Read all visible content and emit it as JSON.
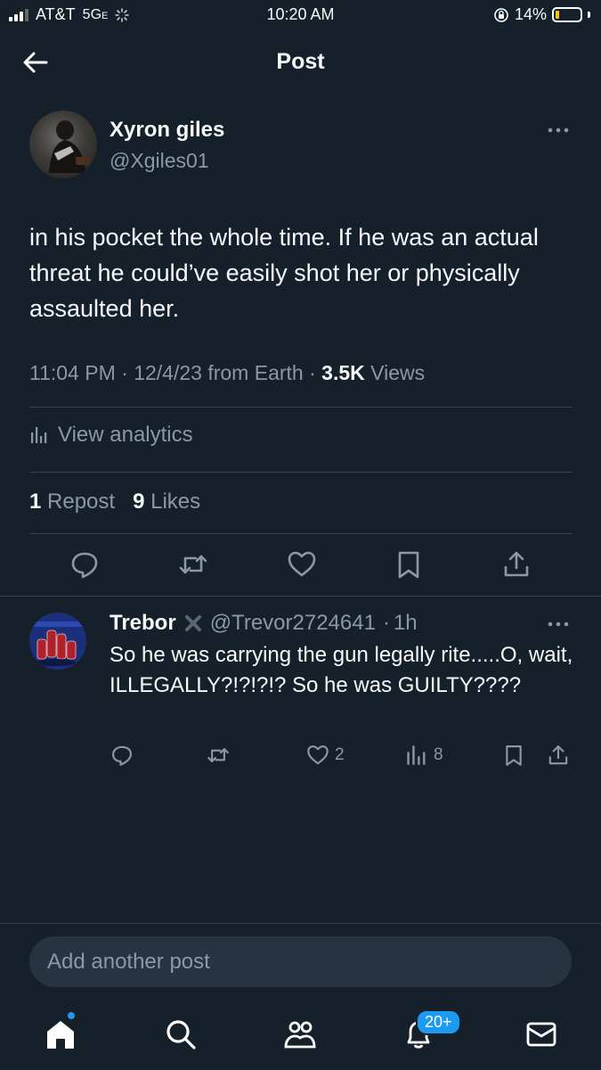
{
  "status_bar": {
    "carrier": "AT&T",
    "network": "5G",
    "network_suffix": "E",
    "time": "10:20 AM",
    "battery": "14%",
    "battery_level": 0.14
  },
  "header": {
    "title": "Post"
  },
  "post": {
    "author_name": "Xyron giles",
    "author_handle": "@Xgiles01",
    "text": "in his pocket the whole time. If he was an actual threat he could’ve easily shot her or physically assaulted her.",
    "time": "11:04 PM",
    "date": "12/4/23",
    "source": "from Earth",
    "views_count": "3.5K",
    "views_label": "Views",
    "analytics_label": "View analytics",
    "reposts_count": "1",
    "reposts_label": "Repost",
    "likes_count": "9",
    "likes_label": "Likes"
  },
  "reply": {
    "author_name": "Trebor",
    "author_handle": "@Trevor2724641",
    "age": "1h",
    "text": "So he was carrying the gun legally rite.....O, wait, ILLEGALLY?!?!?!? So he was GUILTY????",
    "likes": "2",
    "views": "8"
  },
  "compose": {
    "placeholder": "Add another post"
  },
  "nav": {
    "notifications_badge": "20+"
  },
  "colors": {
    "background": "#15202b",
    "accent": "#1d9bf0",
    "muted": "#8b98a5",
    "text": "#f7f9f9"
  }
}
